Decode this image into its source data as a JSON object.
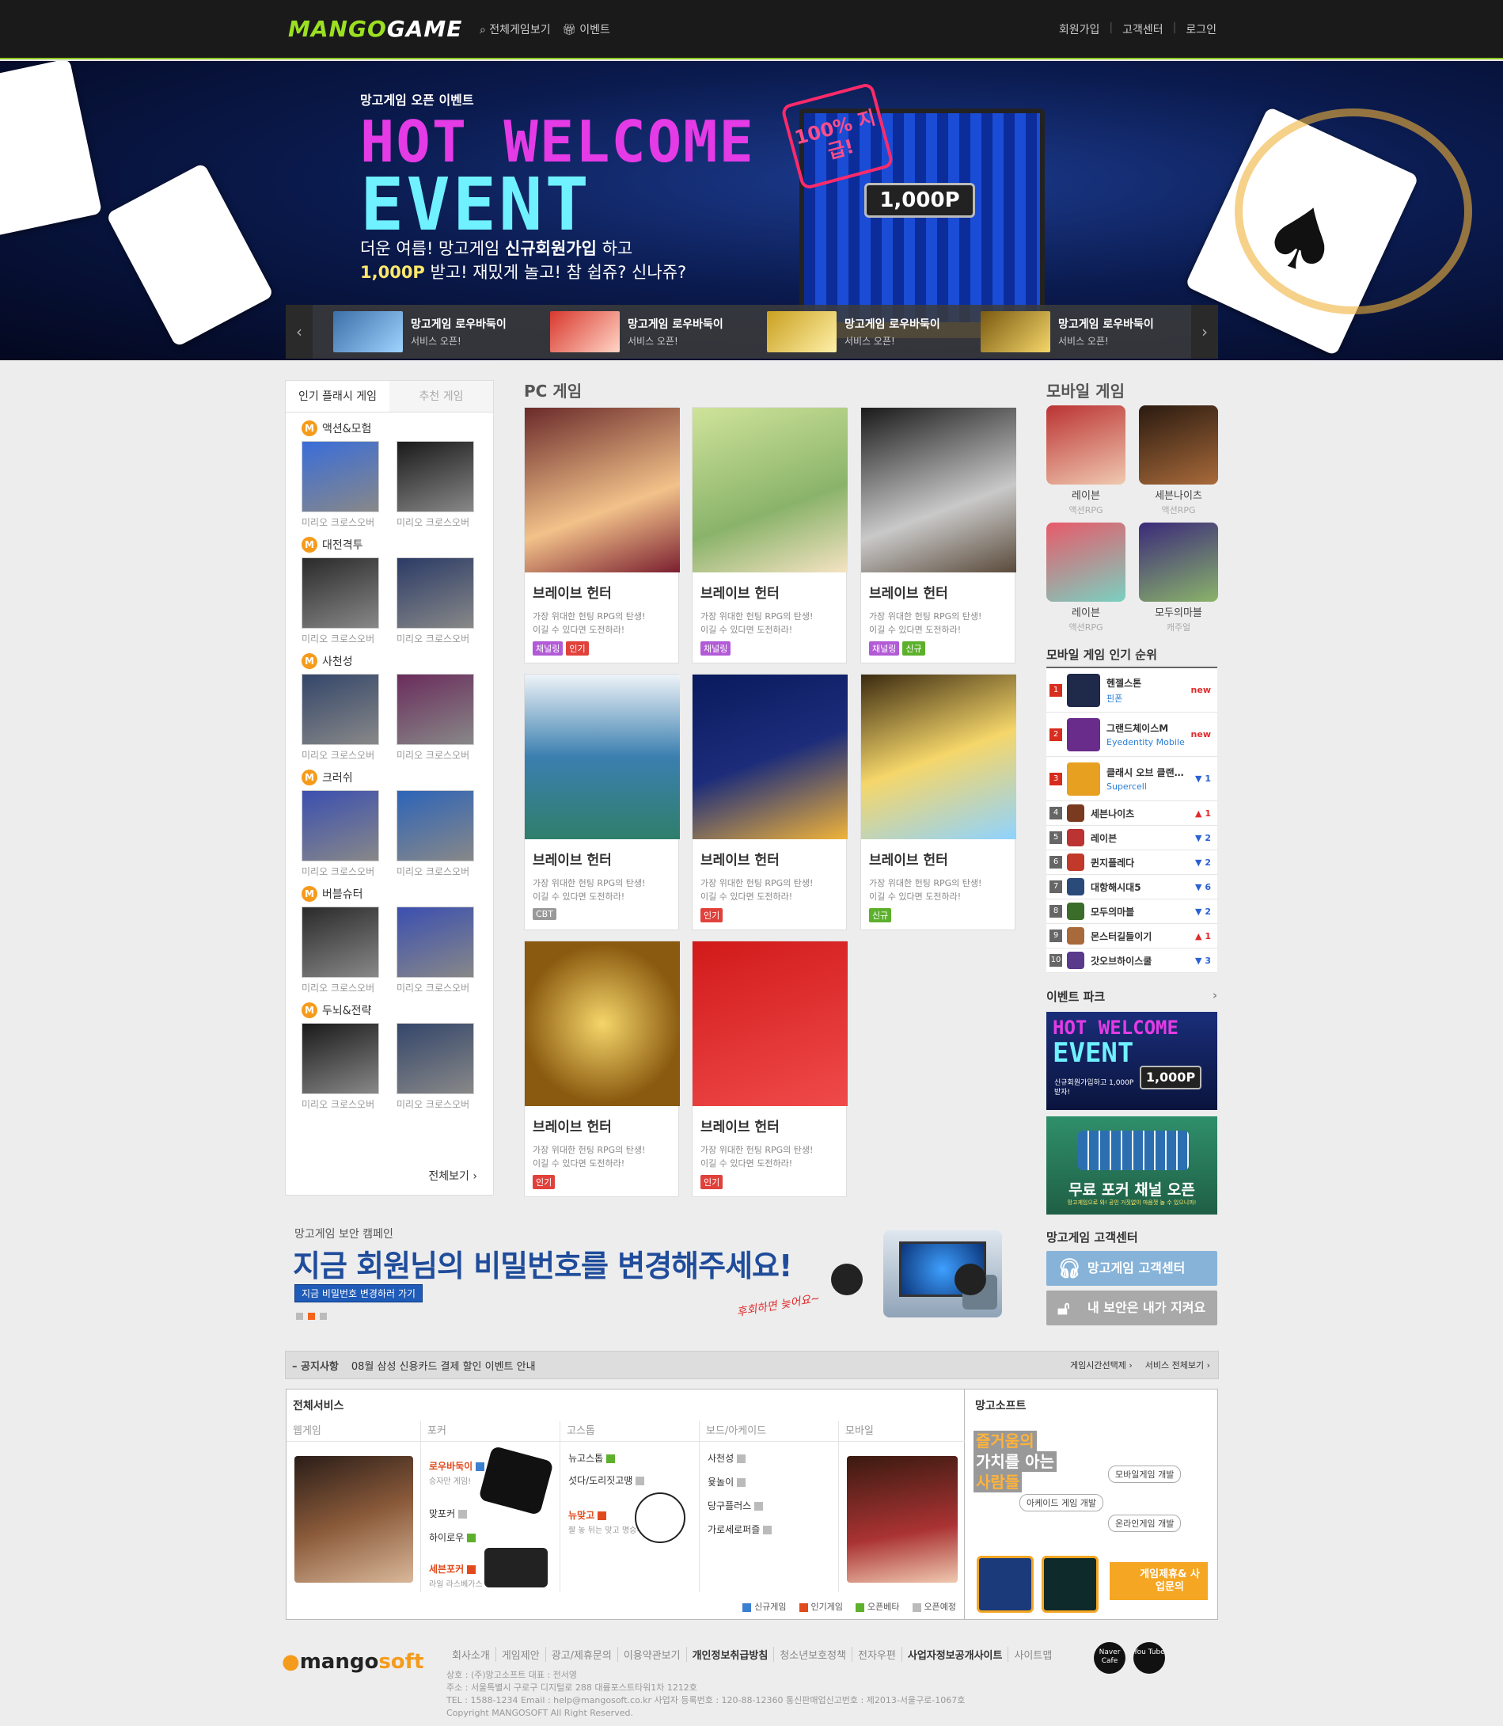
{
  "header": {
    "logo_a": "MANGO",
    "logo_b": "GAME",
    "nav": [
      {
        "label": "전체게임보기"
      },
      {
        "label": "이벤트"
      }
    ],
    "links": [
      "회원가입",
      "고객센터",
      "로그인"
    ]
  },
  "hero": {
    "kicker": "망고게임 오픈 이벤트",
    "title_1": "HOT WELCOME",
    "title_2": "EVENT",
    "desc_1a": "더운 여름! 망고게임 ",
    "desc_1b": "신규회원가입",
    "desc_1c": " 하고",
    "desc_2a": "1,000P",
    "desc_2b": " 받고! 재밌게 놀고! 참 쉽쥬? 신나쥬?",
    "sticker": "100% 지급!",
    "badge": "1,000P",
    "strip": [
      {
        "title": "망고게임 로우바둑이",
        "sub": "서비스 오픈!"
      },
      {
        "title": "망고게임 로우바둑이",
        "sub": "서비스 오픈!"
      },
      {
        "title": "망고게임 로우바둑이",
        "sub": "서비스 오픈!"
      },
      {
        "title": "망고게임 로우바둑이",
        "sub": "서비스 오픈!"
      }
    ]
  },
  "sidebar": {
    "tabs": [
      "인기 플래시 게임",
      "추천 게임"
    ],
    "categories": [
      {
        "name": "액션&모험",
        "games": [
          "미리오 크로스오버",
          "미리오 크로스오버"
        ]
      },
      {
        "name": "대전격투",
        "games": [
          "미리오 크로스오버",
          "미리오 크로스오버"
        ]
      },
      {
        "name": "사천성",
        "games": [
          "미리오 크로스오버",
          "미리오 크로스오버"
        ]
      },
      {
        "name": "크러쉬",
        "games": [
          "미리오 크로스오버",
          "미리오 크로스오버"
        ]
      },
      {
        "name": "버블슈터",
        "games": [
          "미리오 크로스오버",
          "미리오 크로스오버"
        ]
      },
      {
        "name": "두뇌&전략",
        "games": [
          "미리오 크로스오버",
          "미리오 크로스오버"
        ]
      }
    ],
    "view_all": "전체보기 ›"
  },
  "pc": {
    "title": "PC 게임",
    "games": [
      {
        "name": "브레이브 헌터",
        "d1": "가장 위대한 헌팅 RPG의 탄생!",
        "d2": "이길 수 있다면 도전하라!",
        "tags": [
          {
            "t": "채널링",
            "c": "#b25bd6"
          },
          {
            "t": "인기",
            "c": "#e0423b"
          }
        ]
      },
      {
        "name": "브레이브 헌터",
        "d1": "가장 위대한 헌팅 RPG의 탄생!",
        "d2": "이길 수 있다면 도전하라!",
        "tags": [
          {
            "t": "채널링",
            "c": "#b25bd6"
          }
        ]
      },
      {
        "name": "브레이브 헌터",
        "d1": "가장 위대한 헌팅 RPG의 탄생!",
        "d2": "이길 수 있다면 도전하라!",
        "tags": [
          {
            "t": "채널링",
            "c": "#b25bd6"
          },
          {
            "t": "신규",
            "c": "#5db02c"
          }
        ]
      },
      {
        "name": "브레이브 헌터",
        "d1": "가장 위대한 헌팅 RPG의 탄생!",
        "d2": "이길 수 있다면 도전하라!",
        "tags": [
          {
            "t": "CBT",
            "c": "#999999"
          }
        ]
      },
      {
        "name": "브레이브 헌터",
        "d1": "가장 위대한 헌팅 RPG의 탄생!",
        "d2": "이길 수 있다면 도전하라!",
        "tags": [
          {
            "t": "인기",
            "c": "#e0423b"
          }
        ]
      },
      {
        "name": "브레이브 헌터",
        "d1": "가장 위대한 헌팅 RPG의 탄생!",
        "d2": "이길 수 있다면 도전하라!",
        "tags": [
          {
            "t": "신규",
            "c": "#5db02c"
          }
        ]
      },
      {
        "name": "브레이브 헌터",
        "d1": "가장 위대한 헌팅 RPG의 탄생!",
        "d2": "이길 수 있다면 도전하라!",
        "tags": [
          {
            "t": "인기",
            "c": "#e0423b"
          }
        ]
      },
      {
        "name": "브레이브 헌터",
        "d1": "가장 위대한 헌팅 RPG의 탄생!",
        "d2": "이길 수 있다면 도전하라!",
        "tags": [
          {
            "t": "인기",
            "c": "#e0423b"
          }
        ]
      }
    ]
  },
  "mobile": {
    "title": "모바일 게임",
    "apps": [
      {
        "name": "레이븐",
        "cat": "액션RPG"
      },
      {
        "name": "세븐나이츠",
        "cat": "액션RPG"
      },
      {
        "name": "레이븐",
        "cat": "액션RPG"
      },
      {
        "name": "모두의마블",
        "cat": "캐주얼"
      }
    ],
    "rank_title": "모바일 게임 인기 순위",
    "ranks": [
      {
        "n": "1",
        "name": "헨젤스톤",
        "sub": "핀폰",
        "chg": "new",
        "dir": "nw"
      },
      {
        "n": "2",
        "name": "그랜드체이스M",
        "sub": "Eyedentity Mobile",
        "chg": "new",
        "dir": "nw"
      },
      {
        "n": "3",
        "name": "클래시 오브 클랜…",
        "sub": "Supercell",
        "chg": "▼ 1",
        "dir": "dn"
      },
      {
        "n": "4",
        "name": "세븐나이츠",
        "sub": "",
        "chg": "▲ 1",
        "dir": "up"
      },
      {
        "n": "5",
        "name": "레이븐",
        "sub": "",
        "chg": "▼ 2",
        "dir": "dn"
      },
      {
        "n": "6",
        "name": "퀸지플레다",
        "sub": "",
        "chg": "▼ 2",
        "dir": "dn"
      },
      {
        "n": "7",
        "name": "대항해시대5",
        "sub": "",
        "chg": "▼ 6",
        "dir": "dn"
      },
      {
        "n": "8",
        "name": "모두의마블",
        "sub": "",
        "chg": "▼ 2",
        "dir": "dn"
      },
      {
        "n": "9",
        "name": "몬스터길들이기",
        "sub": "",
        "chg": "▲ 1",
        "dir": "up"
      },
      {
        "n": "10",
        "name": "갓오브하이스쿨",
        "sub": "",
        "chg": "▼ 3",
        "dir": "dn"
      }
    ],
    "event_park": "이벤트 파크",
    "ev1_a": "HOT WELCOME",
    "ev1_b": "EVENT",
    "ev1_c": "신규회원가입하고 1,000P 받자!",
    "ev1_badge": "1,000P",
    "ev2": "무료 포커 채널 오픈",
    "ev2_sub": "망고게임으로 와! 공인 거짓없이 마음껏 놀 수 있으니까!",
    "cs_title": "망고게임 고객센터",
    "cs_btn": "망고게임 고객센터",
    "sec_btn": "내 보안은 내가 지켜요"
  },
  "security": {
    "kicker": "망고게임 보안 캠페인",
    "headline": "지금 회원님의 비밀번호를 변경해주세요!",
    "button": "지금 비밀번호 변경하러 가기",
    "script": "후회하면 늦어요~"
  },
  "notice": {
    "label": "공지사항",
    "text": "08월 삼성 신용카드 결제 할인 이벤트 안내",
    "link1": "게임시간선택제 ›",
    "link2": "서비스 전체보기 ›"
  },
  "services": {
    "title": "전체서비스",
    "side_title": "망고소프트",
    "cols": [
      "웹게임",
      "포커",
      "고스톱",
      "보드/아케이드",
      "모바일"
    ],
    "poker": [
      {
        "name": "로우바둑이",
        "sub": "승자만 게임!",
        "hl": true,
        "badge": "n"
      },
      {
        "name": "맞포커",
        "sub": "",
        "hl": false,
        "badge": "g"
      },
      {
        "name": "하이로우",
        "sub": "",
        "hl": false,
        "badge": "o"
      },
      {
        "name": "세븐포커",
        "sub": "라일 라스베가스",
        "hl": true,
        "badge": "h"
      }
    ],
    "gostop": [
      {
        "name": "뉴고스톱",
        "sub": "",
        "hl": false,
        "badge": "o"
      },
      {
        "name": "섯다/도리짓고땡",
        "sub": "",
        "hl": false,
        "badge": "g"
      },
      {
        "name": "뉴맞고",
        "sub": "짤 놓 뒤는 맞고 명승부",
        "hl": true,
        "badge": "h"
      }
    ],
    "board": [
      {
        "name": "사천성",
        "badge": "g"
      },
      {
        "name": "윷놀이",
        "badge": "g"
      },
      {
        "name": "당구플러스",
        "badge": "g"
      },
      {
        "name": "가로세로퍼즐",
        "badge": "g"
      }
    ],
    "legend": [
      {
        "t": "신규게임",
        "c": "#3b7fd0",
        "l": "N"
      },
      {
        "t": "인기게임",
        "c": "#e14a1c",
        "l": "H"
      },
      {
        "t": "오픈베타",
        "c": "#5db02c",
        "l": "B"
      },
      {
        "t": "오픈예정",
        "c": "#bbbbbb",
        "l": "O"
      }
    ],
    "slogan_1": "즐거움의",
    "slogan_2": "가치를 아는",
    "slogan_3": "사람들",
    "tag_a": "모바일게임 개발",
    "tag_b": "아케이드 게임 개발",
    "tag_c": "온라인게임 개발",
    "biz": "게임제휴& 사업문의"
  },
  "footer": {
    "brand_a": "mango",
    "brand_b": "soft",
    "links": [
      {
        "t": "회사소개",
        "b": false
      },
      {
        "t": "게임제안",
        "b": false
      },
      {
        "t": "광고/제휴문의",
        "b": false
      },
      {
        "t": "이용약관보기",
        "b": false
      },
      {
        "t": "개인정보취급방침",
        "b": true
      },
      {
        "t": "청소년보호정책",
        "b": false
      },
      {
        "t": "전자우편",
        "b": false
      },
      {
        "t": "사업자정보공개사이트",
        "b": true
      },
      {
        "t": "사이트맵",
        "b": false
      }
    ],
    "info_1": "상호 : (주)망고소프트 대표 : 전서영",
    "info_2": "주소 : 서울특별시 구로구 디지털로 288 대륭포스트타워1차 1212호",
    "info_3": "TEL : 1588-1234 Email : help@mangosoft.co.kr 사업자 등록번호 : 120-88-12360 통신판매업신고번호 : 제2013-서울구로-1067호",
    "info_4": "Copyright MANGOSOFT All Right Reserved.",
    "sns1": "Naver Cafe",
    "sns2": "You Tube"
  }
}
